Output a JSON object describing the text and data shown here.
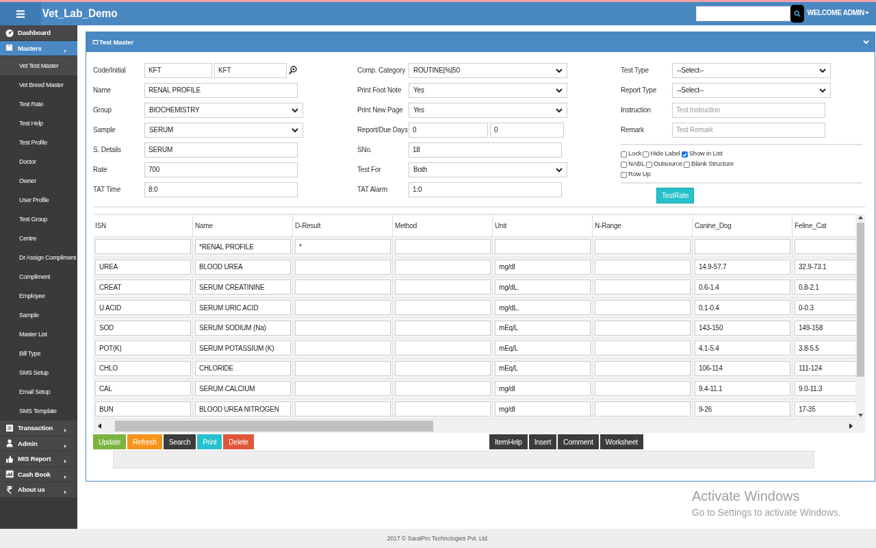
{
  "header": {
    "app_title": "Vet_Lab_Demo",
    "user_menu": "WELCOME ADMIN"
  },
  "sidebar": {
    "items": [
      {
        "label": "Dashboard",
        "selected": false,
        "has_arrow": false
      },
      {
        "label": "Masters",
        "selected": true,
        "has_arrow": true,
        "children": [
          {
            "label": "Vet Test Master",
            "selected": true
          },
          {
            "label": "Vet Breed Master",
            "selected": false
          },
          {
            "label": "Test Rate",
            "selected": false
          },
          {
            "label": "Test Help",
            "selected": false
          },
          {
            "label": "Test Profile",
            "selected": false
          },
          {
            "label": "Doctor",
            "selected": false
          },
          {
            "label": "Owner",
            "selected": false
          },
          {
            "label": "User Profile",
            "selected": false
          },
          {
            "label": "Test Group",
            "selected": false
          },
          {
            "label": "Centre",
            "selected": false
          },
          {
            "label": "Dr Assign Compliment",
            "selected": false
          },
          {
            "label": "Compliment",
            "selected": false
          },
          {
            "label": "Employee",
            "selected": false
          },
          {
            "label": "Sample",
            "selected": false
          },
          {
            "label": "Master List",
            "selected": false
          },
          {
            "label": "Bill Type",
            "selected": false
          },
          {
            "label": "SMS Setup",
            "selected": false
          },
          {
            "label": "Email Setup",
            "selected": false
          },
          {
            "label": "SMS Template",
            "selected": false
          }
        ]
      },
      {
        "label": "Transaction",
        "selected": false,
        "has_arrow": true
      },
      {
        "label": "Admin",
        "selected": false,
        "has_arrow": true
      },
      {
        "label": "MIS Report",
        "selected": false,
        "has_arrow": true
      },
      {
        "label": "Cash Book",
        "selected": false,
        "has_arrow": true
      },
      {
        "label": "About us",
        "selected": false,
        "has_arrow": true
      }
    ]
  },
  "panel": {
    "title": "Test Master",
    "form_columns": [
      [
        {
          "label": "Code/Initial",
          "kind": "pair_lookup",
          "values": [
            "KFT",
            "KFT"
          ]
        },
        {
          "label": "Name",
          "kind": "text",
          "value": "RENAL PROFILE"
        },
        {
          "label": "Group",
          "kind": "select",
          "value": "BIOCHEMISTRY"
        },
        {
          "label": "Sample",
          "kind": "select",
          "value": "SERUM"
        },
        {
          "label": "S. Details",
          "kind": "text",
          "value": "SERUM"
        },
        {
          "label": "Rate",
          "kind": "text",
          "value": "700"
        },
        {
          "label": "TAT Time",
          "kind": "text",
          "value": "8:0"
        }
      ],
      [
        {
          "label": "Comp. Category",
          "kind": "select",
          "value": "ROUTINE|%|50"
        },
        {
          "label": "Print Foot Note",
          "kind": "select",
          "value": "Yes"
        },
        {
          "label": "Print New Page",
          "kind": "select",
          "value": "Yes"
        },
        {
          "label": "Report/Due Days",
          "kind": "pair",
          "values": [
            "0",
            "0"
          ]
        },
        {
          "label": "SNo.",
          "kind": "text",
          "value": "18"
        },
        {
          "label": "Test For",
          "kind": "select",
          "value": "Both"
        },
        {
          "label": "TAT Alarm",
          "kind": "text",
          "value": "1:0"
        }
      ],
      [
        {
          "label": "Test Type",
          "kind": "select",
          "value": "--Select--"
        },
        {
          "label": "Report Type",
          "kind": "select",
          "value": "--Select--"
        },
        {
          "label": "Instruction",
          "kind": "text",
          "placeholder": "Test Instruction"
        },
        {
          "label": "Remark",
          "kind": "text",
          "placeholder": "Test Remark"
        }
      ]
    ],
    "option_rows": [
      [
        {
          "label": "Lock",
          "checked": false
        },
        {
          "label": "Hide Label",
          "checked": false
        },
        {
          "label": "Show in List",
          "checked": true
        }
      ],
      [
        {
          "label": "NABL",
          "checked": false
        },
        {
          "label": "Outsource",
          "checked": false
        },
        {
          "label": "Blank Structure",
          "checked": false
        }
      ],
      [
        {
          "label": "Row Up",
          "checked": false
        }
      ]
    ],
    "test_rate_button": "TestRate",
    "table": {
      "columns": [
        "ISN",
        "Name",
        "D-Result",
        "Method",
        "Unit",
        "N-Range",
        "Canine_Dog",
        "Feline_Cat"
      ],
      "rows": [
        {
          "cells": [
            "",
            "*RENAL PROFILE",
            "*",
            "",
            "",
            "",
            "",
            ""
          ]
        },
        {
          "cells": [
            "UREA",
            "BLOOD UREA",
            "",
            "",
            "mg/dl",
            "",
            "14.9-57.7",
            "32.9-73.1"
          ]
        },
        {
          "cells": [
            "CREAT",
            "SERUM CREATININE",
            "",
            "",
            "mg/dL.",
            "",
            "0.6-1.4",
            "0.8-2.1"
          ]
        },
        {
          "cells": [
            "U ACID",
            "SERUM URIC ACID",
            "",
            "",
            "mg/dL.",
            "",
            "0.1-0.4",
            "0-0.3"
          ]
        },
        {
          "cells": [
            "SOD",
            "SERUM SODIUM (Na)",
            "",
            "",
            "mEq/L",
            "",
            "143-150",
            "149-158"
          ]
        },
        {
          "cells": [
            "POT(K)",
            "SERUM POTASSIUM (K)",
            "",
            "",
            "mEq/L",
            "",
            "4.1-5.4",
            "3.8-5.5"
          ]
        },
        {
          "cells": [
            "CHLO",
            "CHLORIDE",
            "",
            "",
            "mEq/L",
            "",
            "106-114",
            "111-124"
          ]
        },
        {
          "cells": [
            "CAL",
            "SERUM CALCIUM",
            "",
            "",
            "mg/dl",
            "",
            "9.4-11.1",
            "9.0-11.3"
          ]
        },
        {
          "cells": [
            "BUN",
            "BLOOD UREA NITROGEN",
            "",
            "",
            "mg/dl",
            "",
            "9-26",
            "17-35"
          ]
        }
      ]
    },
    "actions_left": [
      {
        "label": "Update",
        "color": "#7cb342"
      },
      {
        "label": "Refresh",
        "color": "#f7941d"
      },
      {
        "label": "Search",
        "color": "#3c3c3c"
      },
      {
        "label": "Print",
        "color": "#26c1cc"
      },
      {
        "label": "Delete",
        "color": "#e1573a"
      }
    ],
    "actions_right": [
      "ItemHelp",
      "Insert",
      "Comment",
      "Worksheet"
    ]
  },
  "footer": "2017 © SaralPro Technologies Pvt. Ltd.",
  "os_notice": {
    "title": "Activate Windows",
    "subtitle": "Go to Settings to activate Windows."
  }
}
